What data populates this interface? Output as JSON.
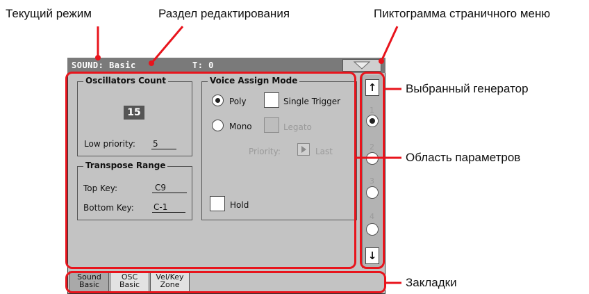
{
  "callouts": {
    "current_mode": "Текущий режим",
    "edit_section": "Раздел редактирования",
    "page_menu_icon": "Пиктограмма страничного меню",
    "selected_generator": "Выбранный генератор",
    "parameter_area": "Область параметров",
    "tabs": "Закладки"
  },
  "titlebar": {
    "mode": "SOUND: Basic",
    "track": "T: 0"
  },
  "oscillators": {
    "title": "Oscillators Count",
    "count": "15",
    "low_priority_label": "Low priority:",
    "low_priority_value": "5"
  },
  "transpose": {
    "title": "Transpose Range",
    "top_key_label": "Top Key:",
    "top_key_value": "C9",
    "bottom_key_label": "Bottom Key:",
    "bottom_key_value": "C-1"
  },
  "voice_assign": {
    "title": "Voice Assign Mode",
    "poly": "Poly",
    "mono": "Mono",
    "single_trigger": "Single Trigger",
    "legato": "Legato",
    "priority_label": "Priority:",
    "priority_value": "Last",
    "hold": "Hold",
    "selected": "Poly"
  },
  "generators": {
    "numbers": [
      "1",
      "2",
      "3",
      "4"
    ],
    "selected": "1",
    "up_arrow": "↑",
    "down_arrow": "↓"
  },
  "tabs": [
    {
      "line1": "Sound",
      "line2": "Basic",
      "active": true
    },
    {
      "line1": "OSC",
      "line2": "Basic",
      "active": false
    },
    {
      "line1": "Vel/Key",
      "line2": "Zone",
      "active": false
    }
  ],
  "colors": {
    "highlight": "#e8141c",
    "screen_bg": "#c3c3c3",
    "titlebar_bg": "#7a7a7a"
  }
}
